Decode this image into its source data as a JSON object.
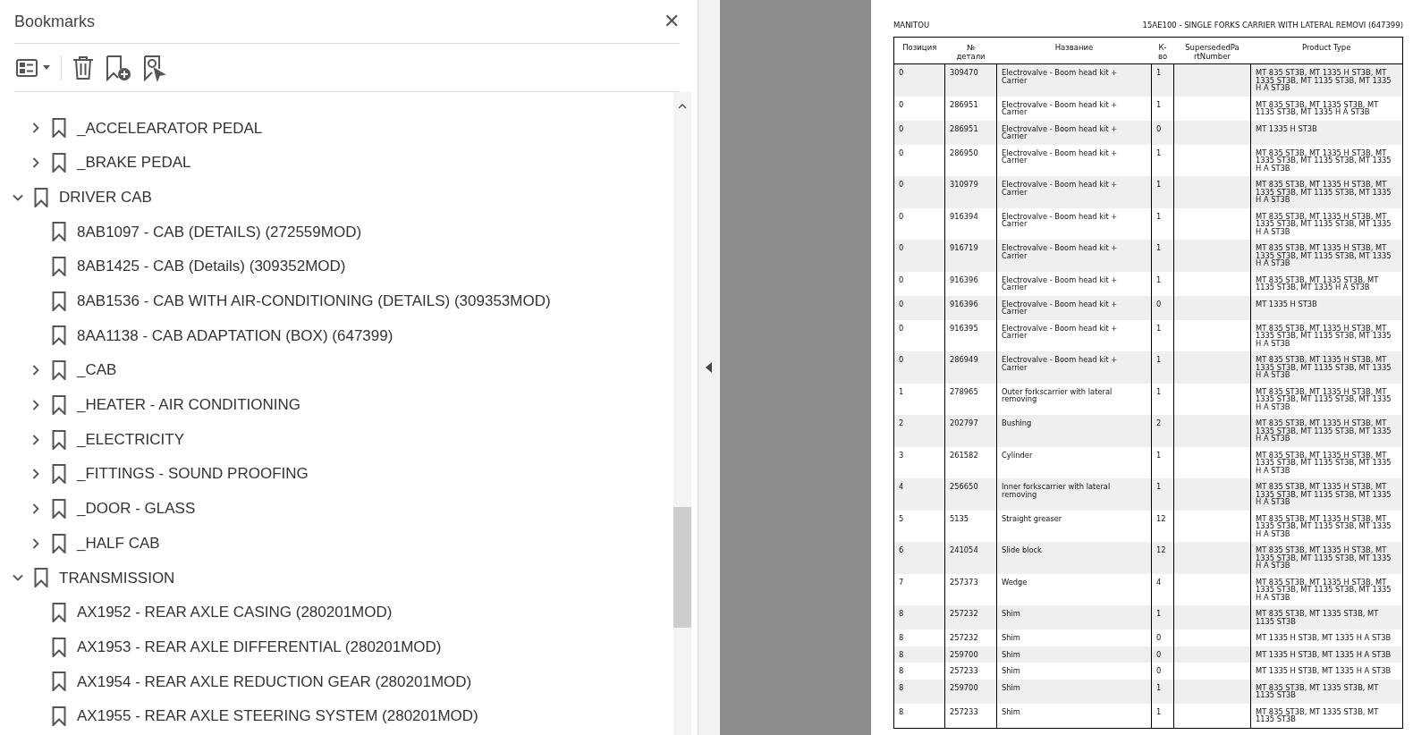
{
  "bookmarks_panel": {
    "title": "Bookmarks",
    "close": "✕"
  },
  "bookmarks": [
    {
      "children": [
        {
          "label": "_ACCELEARATOR PEDAL",
          "expanded": false
        },
        {
          "label": "_BRAKE PEDAL",
          "expanded": false
        }
      ]
    },
    {
      "label": "DRIVER CAB",
      "expanded": true,
      "children": [
        {
          "label": "8AB1097 - CAB (DETAILS) (272559MOD)"
        },
        {
          "label": "8AB1425 - CAB (Details) (309352MOD)"
        },
        {
          "label": "8AB1536 - CAB WITH AIR-CONDITIONING (DETAILS) (309353MOD)"
        },
        {
          "label": "8AA1138 - CAB ADAPTATION (BOX) (647399)"
        },
        {
          "label": "_CAB",
          "expanded": false
        },
        {
          "label": "_HEATER - AIR CONDITIONING",
          "expanded": false
        },
        {
          "label": "_ELECTRICITY",
          "expanded": false
        },
        {
          "label": "_FITTINGS - SOUND PROOFING",
          "expanded": false
        },
        {
          "label": "_DOOR - GLASS",
          "expanded": false
        },
        {
          "label": "_HALF CAB",
          "expanded": false
        }
      ]
    },
    {
      "label": "TRANSMISSION",
      "expanded": true,
      "children": [
        {
          "label": "AX1952 - REAR AXLE CASING (280201MOD)"
        },
        {
          "label": "AX1953 - REAR AXLE DIFFERENTIAL (280201MOD)"
        },
        {
          "label": "AX1954 - REAR AXLE REDUCTION GEAR (280201MOD)"
        },
        {
          "label": "AX1955 - REAR AXLE STEERING SYSTEM (280201MOD)"
        }
      ]
    }
  ],
  "document": {
    "header_left": "MANITOU",
    "header_right": "15AE100 - SINGLE FORKS CARRIER WITH LATERAL REMOVI (647399)",
    "table": {
      "columns": [
        "Позиция",
        "№ детали",
        "Название",
        "К-во",
        "SupersededPa rtNumber",
        "Product Type"
      ],
      "rows": [
        [
          "0",
          "309470",
          "Electrovalve - Boom head kit + Carrier",
          "1",
          "",
          "MT 835 ST3B, MT 1335 H ST3B, MT 1335 ST3B, MT 1135 ST3B, MT 1335 H A ST3B"
        ],
        [
          "0",
          "286951",
          "Electrovalve - Boom head kit + Carrier",
          "1",
          "",
          "MT 835 ST3B, MT 1335 ST3B, MT 1135 ST3B, MT 1335 H A ST3B"
        ],
        [
          "0",
          "286951",
          "Electrovalve - Boom head kit + Carrier",
          "0",
          "",
          "MT 1335 H ST3B"
        ],
        [
          "0",
          "286950",
          "Electrovalve - Boom head kit + Carrier",
          "1",
          "",
          "MT 835 ST3B, MT 1335 H ST3B, MT 1335 ST3B, MT 1135 ST3B, MT 1335 H A ST3B"
        ],
        [
          "0",
          "310979",
          "Electrovalve - Boom head kit + Carrier",
          "1",
          "",
          "MT 835 ST3B, MT 1335 H ST3B, MT 1335 ST3B, MT 1135 ST3B, MT 1335 H A ST3B"
        ],
        [
          "0",
          "916394",
          "Electrovalve - Boom head kit + Carrier",
          "1",
          "",
          "MT 835 ST3B, MT 1335 H ST3B, MT 1335 ST3B, MT 1135 ST3B, MT 1335 H A ST3B"
        ],
        [
          "0",
          "916719",
          "Electrovalve - Boom head kit + Carrier",
          "1",
          "",
          "MT 835 ST3B, MT 1335 H ST3B, MT 1335 ST3B, MT 1135 ST3B, MT 1335 H A ST3B"
        ],
        [
          "0",
          "916396",
          "Electrovalve - Boom head kit + Carrier",
          "1",
          "",
          "MT 835 ST3B, MT 1335 ST3B, MT 1135 ST3B, MT 1335 H A ST3B"
        ],
        [
          "0",
          "916396",
          "Electrovalve - Boom head kit + Carrier",
          "0",
          "",
          "MT 1335 H ST3B"
        ],
        [
          "0",
          "916395",
          "Electrovalve - Boom head kit + Carrier",
          "1",
          "",
          "MT 835 ST3B, MT 1335 H ST3B, MT 1335 ST3B, MT 1135 ST3B, MT 1335 H A ST3B"
        ],
        [
          "0",
          "286949",
          "Electrovalve - Boom head kit + Carrier",
          "1",
          "",
          "MT 835 ST3B, MT 1335 H ST3B, MT 1335 ST3B, MT 1135 ST3B, MT 1335 H A ST3B"
        ],
        [
          "1",
          "278965",
          "Outer forkscarrier with lateral removing",
          "1",
          "",
          "MT 835 ST3B, MT 1335 H ST3B, MT 1335 ST3B, MT 1135 ST3B, MT 1335 H A ST3B"
        ],
        [
          "2",
          "202797",
          "Bushing",
          "2",
          "",
          "MT 835 ST3B, MT 1335 H ST3B, MT 1335 ST3B, MT 1135 ST3B, MT 1335 H A ST3B"
        ],
        [
          "3",
          "261582",
          "Cylinder",
          "1",
          "",
          "MT 835 ST3B, MT 1335 H ST3B, MT 1335 ST3B, MT 1135 ST3B, MT 1335 H A ST3B"
        ],
        [
          "4",
          "256650",
          "Inner forkscarrier with lateral removing",
          "1",
          "",
          "MT 835 ST3B, MT 1335 H ST3B, MT 1335 ST3B, MT 1135 ST3B, MT 1335 H A ST3B"
        ],
        [
          "5",
          "5135",
          "Straight greaser",
          "12",
          "",
          "MT 835 ST3B, MT 1335 H ST3B, MT 1335 ST3B, MT 1135 ST3B, MT 1335 H A ST3B"
        ],
        [
          "6",
          "241054",
          "Slide block",
          "12",
          "",
          "MT 835 ST3B, MT 1335 H ST3B, MT 1335 ST3B, MT 1135 ST3B, MT 1335 H A ST3B"
        ],
        [
          "7",
          "257373",
          "Wedge",
          "4",
          "",
          "MT 835 ST3B, MT 1335 H ST3B, MT 1335 ST3B, MT 1135 ST3B, MT 1335 H A ST3B"
        ],
        [
          "8",
          "257232",
          "Shim",
          "1",
          "",
          "MT 835 ST3B, MT 1335 ST3B, MT 1135 ST3B"
        ],
        [
          "8",
          "257232",
          "Shim",
          "0",
          "",
          "MT 1335 H ST3B, MT 1335 H A ST3B"
        ],
        [
          "8",
          "259700",
          "Shim",
          "0",
          "",
          "MT 1335 H ST3B, MT 1335 H A ST3B"
        ],
        [
          "8",
          "257233",
          "Shim",
          "0",
          "",
          "MT 1335 H ST3B, MT 1335 H A ST3B"
        ],
        [
          "8",
          "259700",
          "Shim",
          "1",
          "",
          "MT 835 ST3B, MT 1335 ST3B, MT 1135 ST3B"
        ],
        [
          "8",
          "257233",
          "Shim",
          "1",
          "",
          "MT 835 ST3B, MT 1335 ST3B, MT 1135 ST3B"
        ]
      ]
    }
  }
}
